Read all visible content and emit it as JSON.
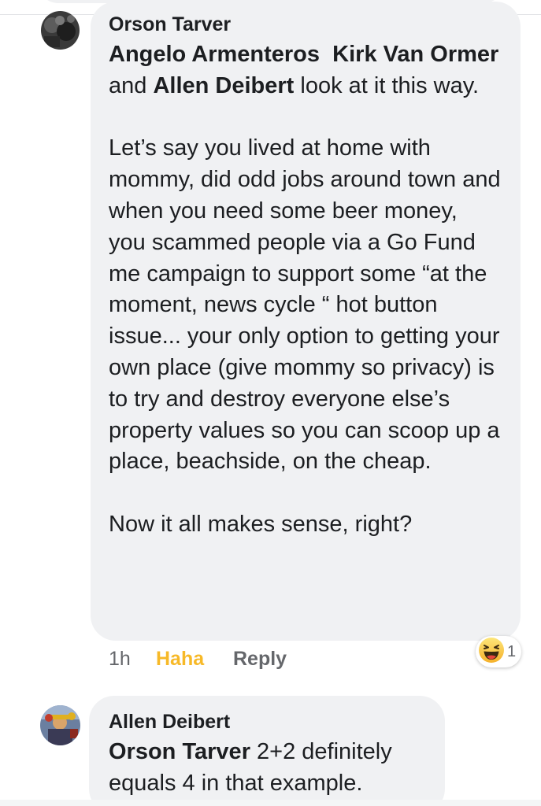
{
  "comments": [
    {
      "author": "Orson Tarver",
      "mentions": [
        "Angelo Armenteros",
        "Kirk Van Ormer",
        "Allen Deibert"
      ],
      "text_part_1": "Angelo Armenteros",
      "text_part_2": "  ",
      "text_part_3": "Kirk Van Ormer",
      "text_part_4": " and ",
      "text_part_5": "Allen Deibert",
      "text_part_6": " look at it this way.\n\nLet’s say you lived at home with mommy, did odd jobs around town and when you need some beer money,  you scammed people via a Go Fund me campaign to support some “at the moment, news cycle “ hot button issue... your only option to getting your own place (give mommy so privacy) is to try and destroy everyone else’s property values so you can scoop up a place, beachside, on the cheap.\n\nNow it all makes sense, right?",
      "time": "1h",
      "reaction_label": "Haha",
      "reply_label": "Reply",
      "reaction_icon": "haha-emoji-icon",
      "reaction_count": "1"
    },
    {
      "author": "Allen Deibert",
      "mention": "Orson Tarver",
      "text": " 2+2 definitely equals 4 in that example."
    }
  ],
  "colors": {
    "bubble": "#f0f1f3",
    "text": "#1c1e21",
    "meta": "#65676b",
    "haha": "#f7b928"
  }
}
